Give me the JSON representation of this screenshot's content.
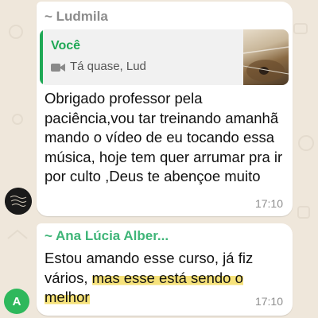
{
  "colors": {
    "background": "#efe7db",
    "quote_accent": "#1fa855",
    "sender2": "#3fb578",
    "highlight": "#f6e27a",
    "avatar2": "#2eb85c"
  },
  "messages": [
    {
      "sender": "~ Ludmila",
      "quote": {
        "author": "Você",
        "icon": "video-camera-icon",
        "text": "Tá quase, Lud"
      },
      "text": "Obrigado professor pela paciência,vou tar treinando amanhã mando o vídeo de eu tocando essa música, hoje tem quer arrumar pra ir por culto ,Deus te abençoe muito",
      "time": "17:10",
      "avatar_icon": "profile-photo-icon"
    },
    {
      "sender": "~ Ana Lúcia Alber...",
      "text_plain": "Estou amando esse curso, já fiz vários, ",
      "text_highlight": "mas esse está sendo o melhor",
      "time": "17:10",
      "avatar_initial": "A"
    }
  ]
}
